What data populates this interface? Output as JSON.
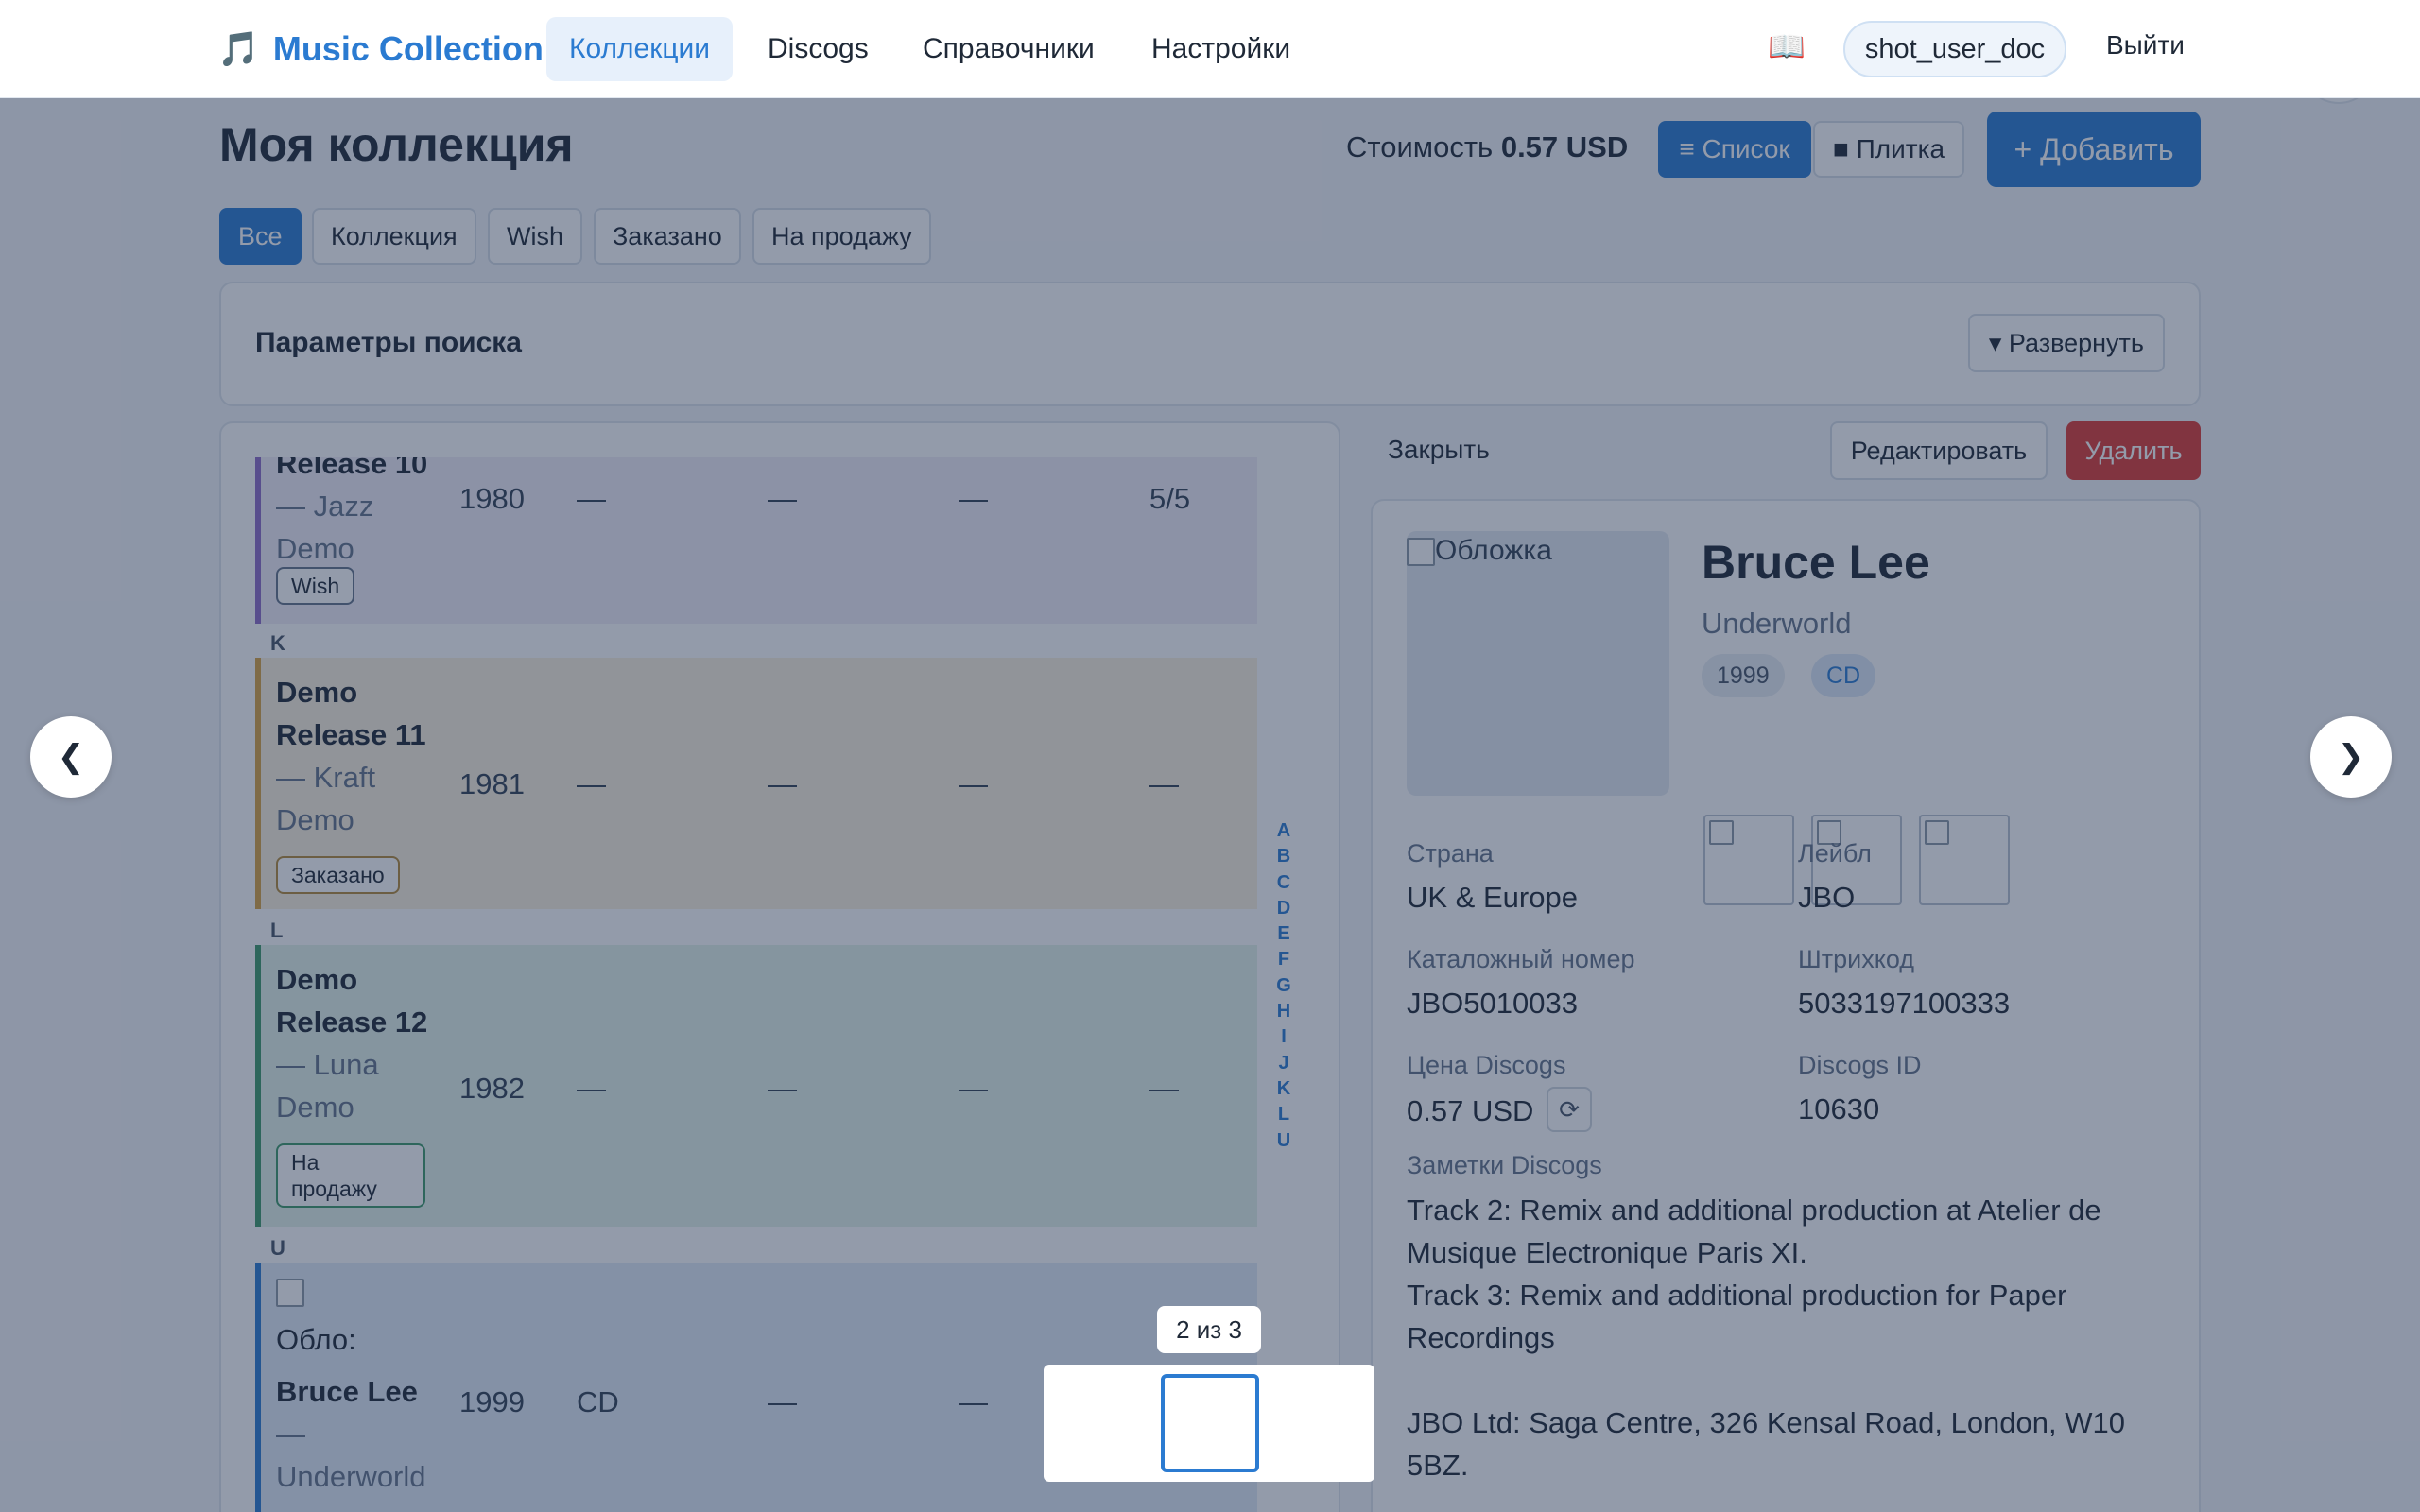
{
  "nav": {
    "brand_icon": "🎵",
    "brand": "Music Collection",
    "links": [
      "Коллекции",
      "Discogs",
      "Справочники",
      "Настройки"
    ],
    "help_icon": "📖",
    "user": "shot_user_doc",
    "logout": "Выйти"
  },
  "page": {
    "title": "Моя коллекция",
    "cost_label": "Стоимость",
    "cost_value": "0.57 USD",
    "view_list": "≡ Список",
    "view_tile": "■ Плитка",
    "add": "+ Добавить",
    "filters": [
      "Все",
      "Коллекция",
      "Wish",
      "Заказано",
      "На продажу"
    ],
    "search_title": "Параметры поиска",
    "expand": "▾ Развернуть"
  },
  "list": {
    "rows": [
      {
        "title": "Release 10",
        "artist": "— Jazz Demo",
        "year": "1980",
        "format": "—",
        "c1": "—",
        "c2": "—",
        "rating": "5/5",
        "status": "Wish"
      },
      {
        "title": "Demo Release 11",
        "artist": "— Kraft Demo",
        "year": "1981",
        "format": "—",
        "c1": "—",
        "c2": "—",
        "rating": "—",
        "status": "Заказано"
      },
      {
        "title": "Demo Release 12",
        "artist": "— Luna Demo",
        "year": "1982",
        "format": "—",
        "c1": "—",
        "c2": "—",
        "rating": "—",
        "status": "На продажу"
      },
      {
        "title": "Bruce Lee",
        "artist": "— Underworld",
        "year": "1999",
        "format": "CD",
        "c1": "—",
        "c2": "—",
        "cover_alt": "Обло:"
      }
    ],
    "letters": [
      "K",
      "L",
      "U"
    ],
    "alphabet": [
      "A",
      "B",
      "C",
      "D",
      "E",
      "F",
      "G",
      "H",
      "I",
      "J",
      "K",
      "L",
      "U"
    ]
  },
  "detail": {
    "close": "Закрыть",
    "edit": "Редактировать",
    "delete": "Удалить",
    "cover_alt": "Обложка",
    "title": "Bruce Lee",
    "artist": "Underworld",
    "year": "1999",
    "format": "CD",
    "fields": {
      "country_label": "Страна",
      "country": "UK & Europe",
      "label_label": "Лейбл",
      "label": "JBO",
      "catno_label": "Каталожный номер",
      "catno": "JBO5010033",
      "barcode_label": "Штрихкод",
      "barcode": "5033197100333",
      "price_label": "Цена Discogs",
      "price": "0.57 USD",
      "id_label": "Discogs ID",
      "id": "10630"
    },
    "notes_label": "Заметки Discogs",
    "notes": [
      "Track 2: Remix and additional production at Atelier de Musique Electronique Paris XI.",
      "Track 3: Remix and additional production for Paper Recordings",
      "",
      "JBO Ltd: Saga Centre, 326 Kensal Road, London, W10 5BZ."
    ]
  },
  "lightbox": {
    "prev": "❮",
    "next": "❯",
    "counter": "2 из 3"
  },
  "colors": {
    "accent": "#2b7bd1",
    "danger": "#dc3b35",
    "wish": "#8e6cc7",
    "ordered": "#d9a441",
    "forsale": "#3e9a6a"
  }
}
